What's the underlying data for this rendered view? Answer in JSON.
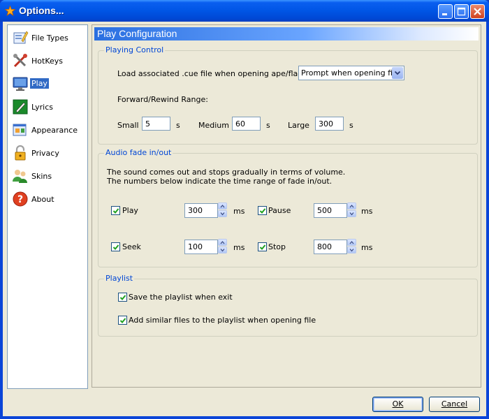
{
  "window": {
    "title": "Options...",
    "icon": "star-icon",
    "controls": [
      "minimize-icon",
      "maximize-icon",
      "close-icon"
    ]
  },
  "sidebar": {
    "items": [
      {
        "label": "File Types",
        "icon": "file-types-icon",
        "active": false
      },
      {
        "label": "HotKeys",
        "icon": "hotkeys-icon",
        "active": false
      },
      {
        "label": "Play",
        "icon": "monitor-icon",
        "active": true
      },
      {
        "label": "Lyrics",
        "icon": "lyrics-pen-icon",
        "active": false
      },
      {
        "label": "Appearance",
        "icon": "appearance-icon",
        "active": false
      },
      {
        "label": "Privacy",
        "icon": "lock-icon",
        "active": false
      },
      {
        "label": "Skins",
        "icon": "skins-users-icon",
        "active": false
      },
      {
        "label": "About",
        "icon": "help-icon",
        "active": false
      }
    ]
  },
  "content": {
    "header": "Play Configuration",
    "playing_control": {
      "legend": "Playing Control",
      "cue_label": "Load associated .cue file when opening ape/flac file",
      "cue_value": "Prompt when opening file",
      "range_label": "Forward/Rewind Range:",
      "small_label": "Small",
      "small_value": "5",
      "medium_label": "Medium",
      "medium_value": "60",
      "large_label": "Large",
      "large_value": "300",
      "unit": "s"
    },
    "fade": {
      "legend": "Audio fade in/out",
      "desc1": "The sound comes out and stops gradually in terms of volume.",
      "desc2": "The numbers below indicate the time range of fade in/out.",
      "unit": "ms",
      "items": [
        {
          "label": "Play",
          "value": "300",
          "checked": true
        },
        {
          "label": "Pause",
          "value": "500",
          "checked": true
        },
        {
          "label": "Seek",
          "value": "100",
          "checked": true
        },
        {
          "label": "Stop",
          "value": "800",
          "checked": true
        }
      ]
    },
    "playlist": {
      "legend": "Playlist",
      "save_label": "Save the playlist when exit",
      "save_checked": true,
      "add_label": "Add similar files to the playlist when opening file",
      "add_checked": true
    }
  },
  "footer": {
    "ok_label": "OK",
    "cancel_label": "Cancel"
  },
  "colors": {
    "title_bar": "#0055e5",
    "selection": "#316ac5",
    "group_legend": "#0046d5",
    "dialog_bg": "#ece9d8"
  }
}
